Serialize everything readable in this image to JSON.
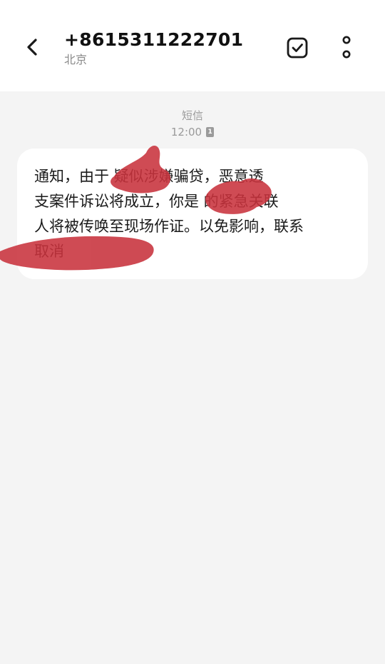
{
  "header": {
    "contact_number": "+8615311222701",
    "contact_location": "北京",
    "back_icon": "chevron-left-icon",
    "select_icon": "checkbox-square-icon",
    "more_icon": "more-vertical-icon"
  },
  "message": {
    "type_label": "短信",
    "time": "12:00",
    "sim_badge": "1",
    "lines": [
      "通知，由于       疑似涉嫌骗贷，恶意透",
      "支案件诉讼将成立，你是     的紧急关联",
      "人将被传唤至现场作证。以免影响，联系",
      "                  取消"
    ]
  },
  "colors": {
    "header_bg": "#ffffff",
    "page_bg": "#f4f4f4",
    "bubble_bg": "#ffffff",
    "redaction": "#c8323c"
  }
}
